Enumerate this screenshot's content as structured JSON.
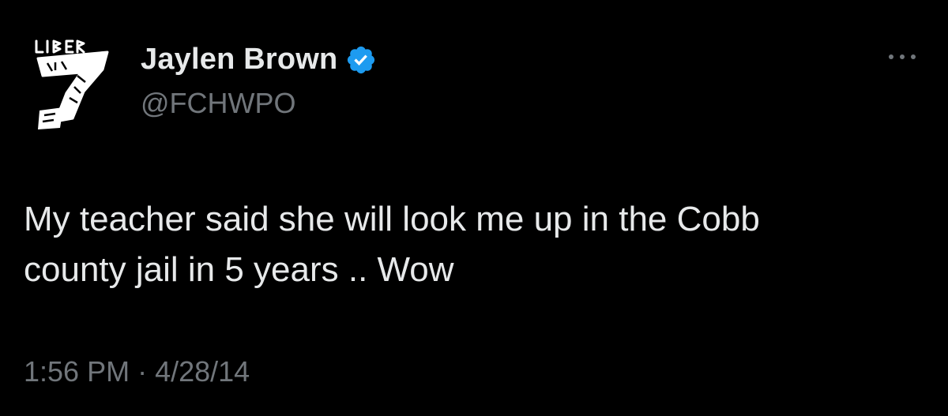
{
  "tweet": {
    "author": {
      "display_name": "Jaylen Brown",
      "handle": "@FCHWPO",
      "verified": true,
      "avatar_text": "LIBERATION 7"
    },
    "text": "My teacher said she will look me up in the Cobb\ncounty jail in 5 years .. Wow",
    "time": "1:56 PM",
    "separator": "·",
    "date": "4/28/14"
  },
  "icons": {
    "verified": "verified-badge-icon",
    "more": "more-options-icon"
  },
  "colors": {
    "background": "#000000",
    "primary_text": "#e7e9ea",
    "secondary_text": "#71767b",
    "verified_blue": "#1d9bf0"
  }
}
